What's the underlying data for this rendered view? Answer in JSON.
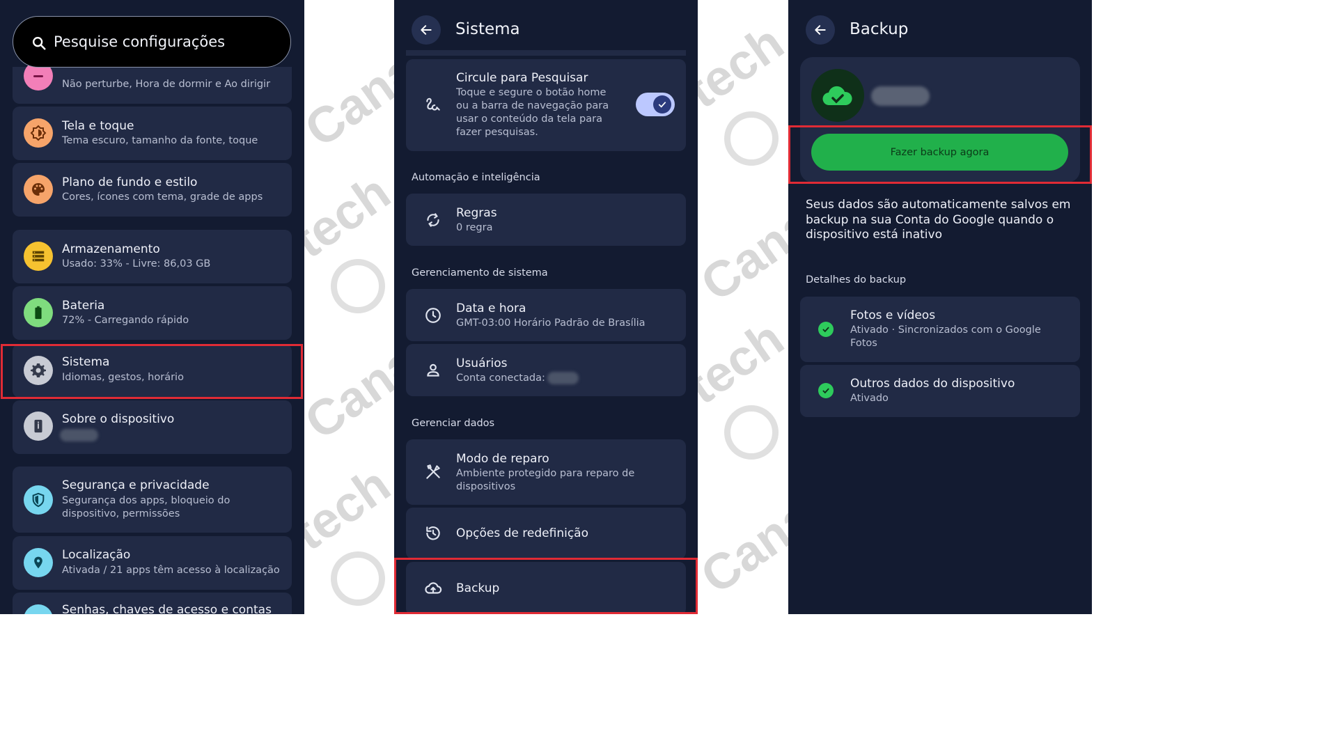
{
  "colors": {
    "bg": "#131b31",
    "card": "#212a45",
    "green": "#21b04b",
    "highlight": "#e02b35",
    "accent_toggle": "#bcc8ff"
  },
  "watermark": {
    "text_a": "Canalt",
    "text_b": "tech",
    "text_c": "Canalte"
  },
  "panel1": {
    "search_placeholder": "Pesquise configurações",
    "items": [
      {
        "title": "",
        "subtitle": "Não perturbe, Hora de dormir e Ao dirigir",
        "icon": "minus-circle-icon"
      },
      {
        "title": "Tela e toque",
        "subtitle": "Tema escuro, tamanho da fonte, toque",
        "icon": "brightness-icon"
      },
      {
        "title": "Plano de fundo e estilo",
        "subtitle": "Cores, ícones com tema, grade de apps",
        "icon": "palette-icon"
      },
      {
        "title": "Armazenamento",
        "subtitle": "Usado: 33% - Livre: 86,03 GB",
        "icon": "storage-icon"
      },
      {
        "title": "Bateria",
        "subtitle": "72% - Carregando rápido",
        "icon": "battery-icon"
      },
      {
        "title": "Sistema",
        "subtitle": "Idiomas, gestos, horário",
        "icon": "gear-icon"
      },
      {
        "title": "Sobre o dispositivo",
        "subtitle": "",
        "icon": "device-info-icon"
      },
      {
        "title": "Segurança e privacidade",
        "subtitle": "Segurança dos apps, bloqueio do dispositivo, permissões",
        "icon": "shield-icon"
      },
      {
        "title": "Localização",
        "subtitle": "Ativada / 21 apps têm acesso à localização",
        "icon": "location-pin-icon"
      },
      {
        "title": "Senhas, chaves de acesso e contas",
        "subtitle": "",
        "icon": "key-icon"
      }
    ]
  },
  "panel2": {
    "title": "Sistema",
    "circle": {
      "title": "Circule para Pesquisar",
      "subtitle": "Toque e segure o botão home ou a barra de navegação para usar o conteúdo da tela para fazer pesquisas.",
      "toggle_on": true
    },
    "sec_auto": "Automação e inteligência",
    "regras": {
      "title": "Regras",
      "subtitle": "0 regra"
    },
    "sec_sys": "Gerenciamento de sistema",
    "data": {
      "title": "Data e hora",
      "subtitle": "GMT-03:00 Horário Padrão de Brasília"
    },
    "usuarios": {
      "title": "Usuários",
      "subtitle": "Conta conectada:"
    },
    "sec_dados": "Gerenciar dados",
    "reparo": {
      "title": "Modo de reparo",
      "subtitle": "Ambiente protegido para reparo de dispositivos"
    },
    "redef": {
      "title": "Opções de redefinição"
    },
    "backup": {
      "title": "Backup"
    }
  },
  "panel3": {
    "title": "Backup",
    "button": "Fazer backup agora",
    "desc": "Seus dados são automaticamente salvos em backup na sua Conta do Google quando o dispositivo está inativo",
    "sec_details": "Detalhes do backup",
    "fotos": {
      "title": "Fotos e vídeos",
      "subtitle": "Ativado · Sincronizados com o Google Fotos"
    },
    "outros": {
      "title": "Outros dados do dispositivo",
      "subtitle": "Ativado"
    }
  }
}
